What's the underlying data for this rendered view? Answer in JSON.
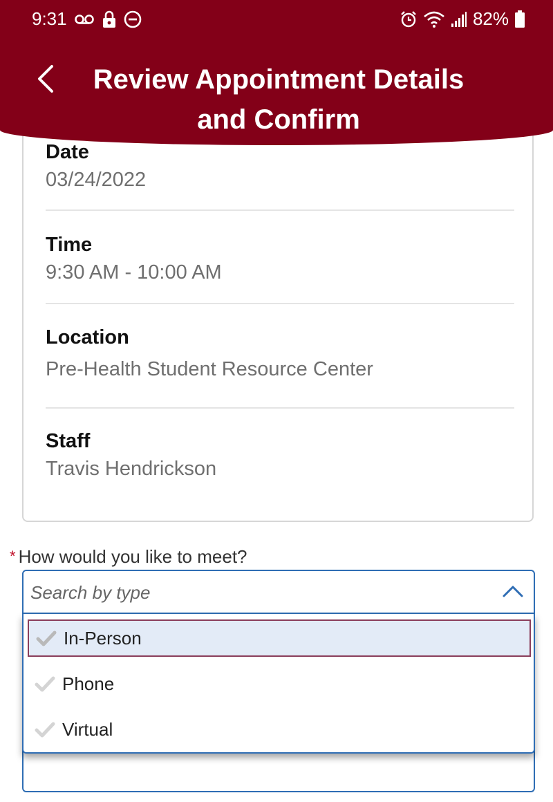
{
  "status_bar": {
    "time": "9:31",
    "battery": "82%",
    "icons": [
      "voicemail-icon",
      "lock-icon",
      "do-not-disturb-icon",
      "alarm-icon",
      "wifi-icon",
      "signal-icon",
      "battery-icon"
    ]
  },
  "header": {
    "title": "Review Appointment Details and Confirm",
    "background_color": "#830018",
    "back_icon": "chevron-left-icon"
  },
  "details": [
    {
      "label": "Date",
      "value": "03/24/2022"
    },
    {
      "label": "Time",
      "value": "9:30 AM - 10:00 AM"
    },
    {
      "label": "Location",
      "value": "Pre-Health Student Resource Center"
    },
    {
      "label": "Staff",
      "value": "Travis Hendrickson"
    }
  ],
  "meeting": {
    "required_mark": "*",
    "label": "How would you like to meet?",
    "placeholder": "Search by type",
    "accent_color": "#2e6db4",
    "options": [
      {
        "label": "In-Person",
        "selected": true
      },
      {
        "label": "Phone",
        "selected": false
      },
      {
        "label": "Virtual",
        "selected": false
      }
    ]
  }
}
